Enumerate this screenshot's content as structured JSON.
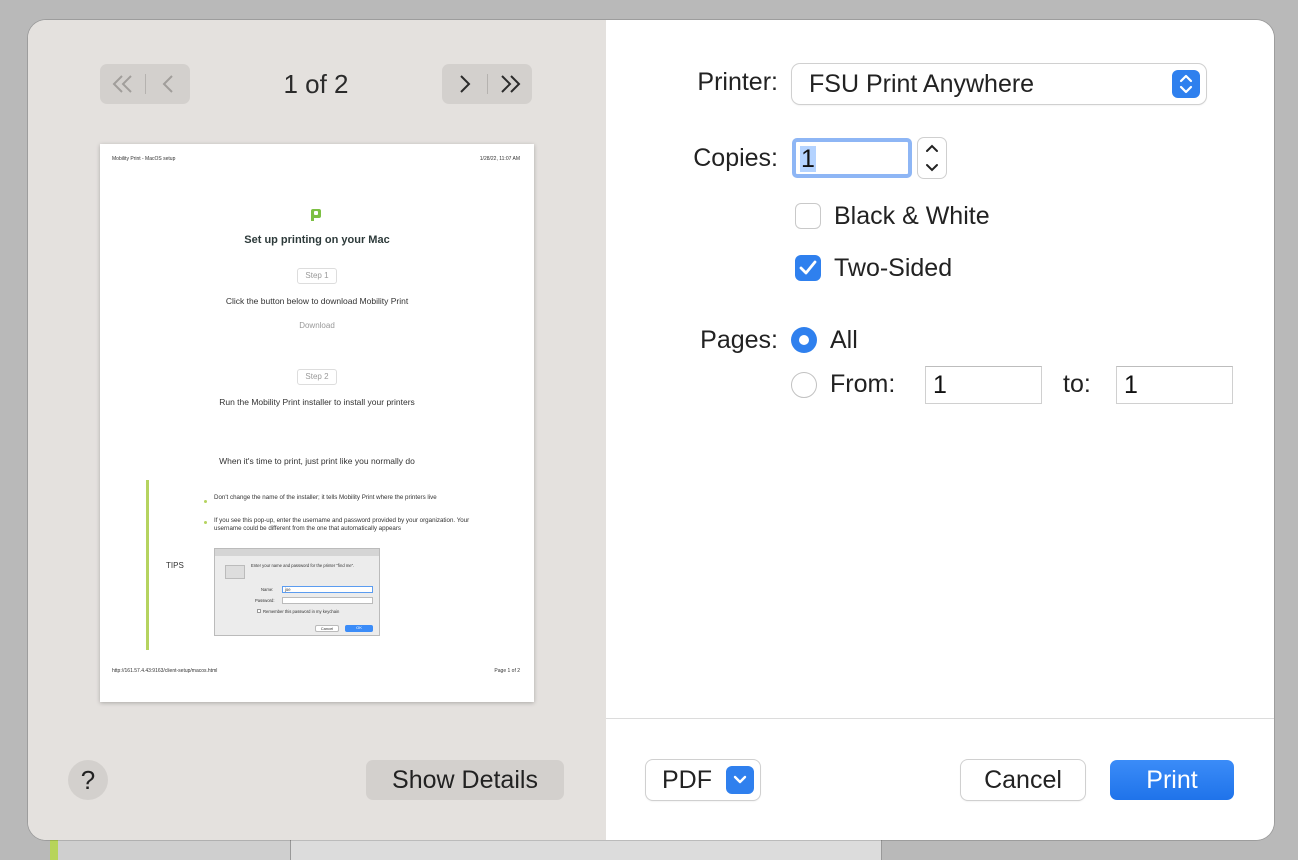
{
  "preview": {
    "page_indicator": "1 of 2",
    "page": {
      "header_left": "Mobility Print - MacOS setup",
      "header_right": "1/28/22, 11:07 AM",
      "title": "Set up printing on your Mac",
      "step1_label": "Step 1",
      "step1_text": "Click the button below to download Mobility Print",
      "download_label": "Download",
      "step2_label": "Step 2",
      "step2_text": "Run the Mobility Print installer to install your printers",
      "print_text": "When it's time to print, just print like you normally do",
      "tips_label": "TIPS",
      "tip1": "Don't change the name of the installer; it tells Mobility Print where the printers live",
      "tip2": "If you see this pop-up, enter the username and password provided by your organization. Your username could be different from the one that automatically appears",
      "mini_dialog": {
        "prompt": "Enter your name and password for the printer \"find me\".",
        "name_label": "Name:",
        "name_value": "joe",
        "password_label": "Password:",
        "remember_label": "Remember this password in my keychain",
        "cancel": "Cancel",
        "ok": "OK"
      },
      "footer_left": "http://161.57.4.43:9163/client-setup/macos.html",
      "footer_right": "Page 1 of 2"
    },
    "help_label": "?",
    "show_details_label": "Show Details"
  },
  "form": {
    "printer_label": "Printer:",
    "printer_value": "FSU Print Anywhere",
    "copies_label": "Copies:",
    "copies_value": "1",
    "black_white_label": "Black & White",
    "black_white_checked": false,
    "two_sided_label": "Two-Sided",
    "two_sided_checked": true,
    "pages_label": "Pages:",
    "pages_all_label": "All",
    "pages_from_label": "From:",
    "pages_from_value": "1",
    "pages_to_label": "to:",
    "pages_to_value": "1"
  },
  "footer": {
    "pdf_label": "PDF",
    "cancel_label": "Cancel",
    "print_label": "Print"
  },
  "colors": {
    "accent": "#2f80ee",
    "panel_left": "#e4e1de",
    "tips_green": "#b5d35f"
  }
}
